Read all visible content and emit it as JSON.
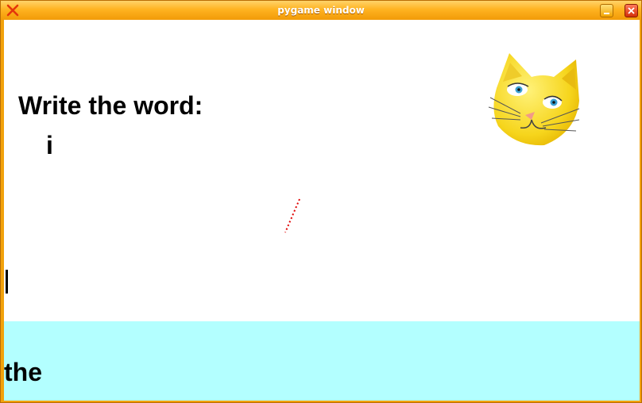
{
  "window": {
    "title": "pygame window",
    "app_icon": "close-x-icon",
    "controls": {
      "minimize_icon": "minimize-icon",
      "close_icon": "close-icon"
    }
  },
  "game": {
    "prompt": "Write the word:",
    "typed_text": "i",
    "target_word": "the",
    "mascot": "cat-face-icon",
    "colors": {
      "word_strip": "#b3ffff",
      "trail": "#e00000",
      "title_bar": "#f7a60e"
    }
  }
}
